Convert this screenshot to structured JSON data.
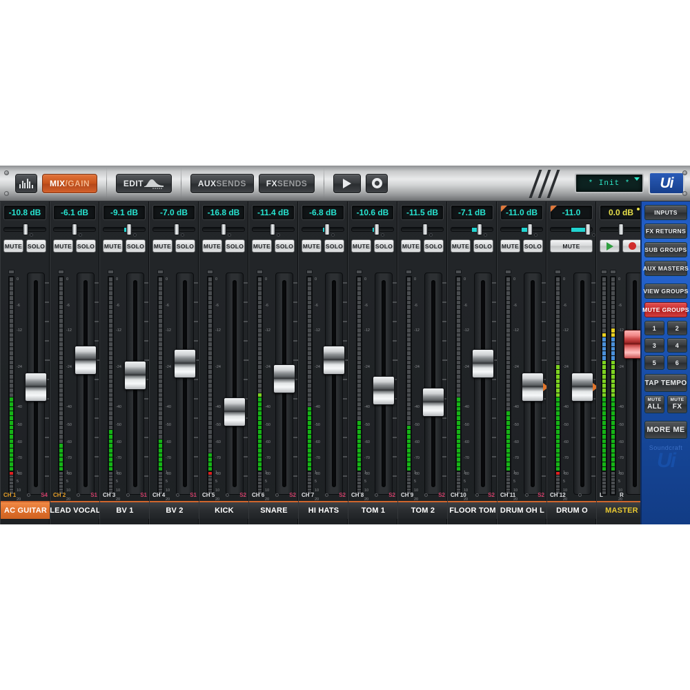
{
  "app": {
    "brand": "Ui",
    "brand_sub": "Soundcraft"
  },
  "toolbar": {
    "meters_icon": "meters-icon",
    "mix_label": "MIX",
    "gain_label": "/GAIN",
    "edit_label": "EDIT",
    "aux_bold": "AUX",
    "aux_dim": "SENDS",
    "fx_bold": "FX",
    "fx_dim": "SENDS",
    "play_icon": "play-icon",
    "settings_icon": "gear-icon",
    "preset_value": "* Init *"
  },
  "meter_scale": [
    "0",
    "-6",
    "-12",
    "-24",
    "-40",
    "-50",
    "-60",
    "-70",
    "-80"
  ],
  "gr_scale": [
    "1",
    "5",
    "10",
    "20"
  ],
  "channels": [
    {
      "ch": "CH 1",
      "name": "AC GUITAR",
      "db": "-10.8 dB",
      "pan": 52,
      "group": "S4",
      "selected": true,
      "gold": true,
      "meter": 42,
      "peak": "yellow",
      "fader": 52,
      "mute": "MUTE",
      "solo": "SOLO"
    },
    {
      "ch": "CH 2",
      "name": "LEAD VOCAL",
      "db": "-6.1 dB",
      "pan": 50,
      "group": "S1",
      "selected": false,
      "gold": true,
      "meter": 18,
      "peak": "orange",
      "fader": 38,
      "mute": "MUTE",
      "solo": "SOLO"
    },
    {
      "ch": "CH 3",
      "name": "BV 1",
      "db": "-9.1 dB",
      "pan": 62,
      "group": "S1",
      "selected": false,
      "gold": false,
      "meter": 26,
      "peak": "orange",
      "fader": 46,
      "mute": "MUTE",
      "solo": "SOLO"
    },
    {
      "ch": "CH 4",
      "name": "BV 2",
      "db": "-7.0 dB",
      "pan": 56,
      "group": "S1",
      "selected": false,
      "gold": false,
      "meter": 20,
      "peak": "orange",
      "fader": 40,
      "mute": "MUTE",
      "solo": "SOLO"
    },
    {
      "ch": "CH 5",
      "name": "KICK",
      "db": "-16.8 dB",
      "pan": 50,
      "group": "S2",
      "selected": false,
      "gold": false,
      "meter": 14,
      "peak": "yellow",
      "fader": 65,
      "mute": "MUTE",
      "solo": "SOLO"
    },
    {
      "ch": "CH 6",
      "name": "SNARE",
      "db": "-11.4 dB",
      "pan": 48,
      "group": "S2",
      "selected": false,
      "gold": false,
      "meter": 44,
      "peak": "yellow",
      "fader": 48,
      "mute": "MUTE",
      "solo": "SOLO"
    },
    {
      "ch": "CH 7",
      "name": "HI HATS",
      "db": "-6.8 dB",
      "pan": 60,
      "group": "S2",
      "selected": false,
      "gold": false,
      "meter": 36,
      "peak": "yellow",
      "fader": 38,
      "mute": "MUTE",
      "solo": "SOLO"
    },
    {
      "ch": "CH 8",
      "name": "TOM 1",
      "db": "-10.6 dB",
      "pan": 60,
      "group": "S2",
      "selected": false,
      "gold": false,
      "meter": 30,
      "peak": "yellow",
      "fader": 54,
      "mute": "MUTE",
      "solo": "SOLO"
    },
    {
      "ch": "CH 9",
      "name": "TOM 2",
      "db": "-11.5 dB",
      "pan": 56,
      "group": "S2",
      "selected": false,
      "gold": false,
      "meter": 28,
      "peak": "yellow",
      "fader": 60,
      "mute": "MUTE",
      "solo": "SOLO"
    },
    {
      "ch": "CH 10",
      "name": "FLOOR TOM",
      "db": "-7.1 dB",
      "pan": 68,
      "group": "S2",
      "selected": false,
      "gold": false,
      "meter": 40,
      "peak": "yellow",
      "fader": 40,
      "mute": "MUTE",
      "solo": "SOLO"
    },
    {
      "ch": "CH 11",
      "name": "DRUM OH L",
      "db": "-11.0 dB",
      "pan": 70,
      "group": "S2",
      "selected": false,
      "gold": false,
      "meter": 34,
      "peak": "yellow",
      "fader": 52,
      "mute": "MUTE",
      "solo": "SOLO"
    },
    {
      "ch": "CH 12",
      "name": "DRUM O",
      "db": "-11.0",
      "pan": 88,
      "group": "",
      "selected": false,
      "gold": false,
      "meter": 56,
      "peak": "yellow",
      "fader": 52,
      "mute": "MUTE",
      "solo": ""
    }
  ],
  "master": {
    "ch_l": "L",
    "ch_r": "R",
    "name": "MASTER",
    "db": "0.0 dB",
    "pan": 50,
    "fader": 30,
    "meter_l": 72,
    "meter_r": 76,
    "play_icon": "play-icon",
    "record_icon": "record-icon"
  },
  "right_panel": {
    "buttons": [
      {
        "label": "INPUTS",
        "state": "normal"
      },
      {
        "label": "FX RETURNS",
        "state": "normal"
      },
      {
        "label": "SUB GROUPS",
        "state": "normal"
      },
      {
        "label": "AUX MASTERS",
        "state": "normal"
      }
    ],
    "view_groups": "VIEW GROUPS",
    "mute_groups": "MUTE GROUPS",
    "group_numbers": [
      "1",
      "2",
      "3",
      "4",
      "5",
      "6"
    ],
    "tap_tempo": "TAP TEMPO",
    "mute_all_top": "MUTE",
    "mute_all_bottom": "ALL",
    "mute_fx_top": "MUTE",
    "mute_fx_bottom": "FX",
    "more_me": "MORE ME"
  },
  "colors": {
    "accent_orange": "#e0702c",
    "lcd_cyan": "#27e3d0",
    "lcd_yellow": "#e8e04a",
    "panel_blue": "#1e58bd",
    "mute_red": "#c82e2e"
  }
}
